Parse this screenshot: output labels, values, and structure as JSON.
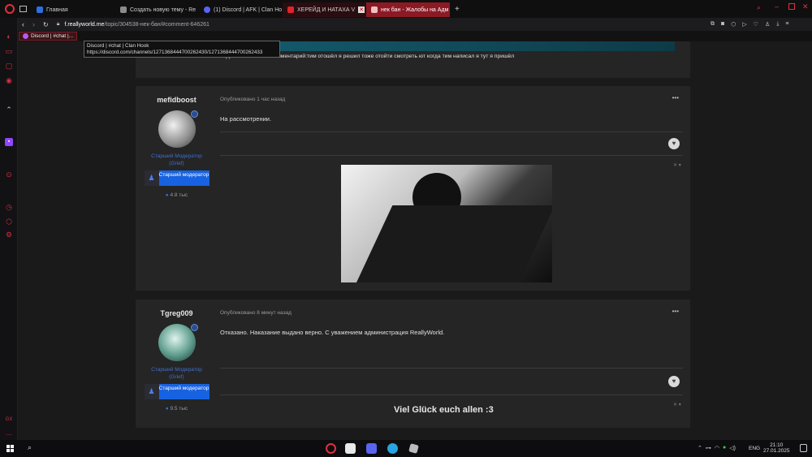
{
  "tabs": [
    {
      "label": "Главная",
      "fav": "#2d6fe0"
    },
    {
      "label": "Создать новую тему - Re",
      "fav": "#8c8c8c"
    },
    {
      "label": "(1) Discord | AFK | Clan Ho",
      "fav": "#5865f2"
    },
    {
      "label": "ХЕРЕЙД И НАТАХА V",
      "fav": "#e0242b"
    },
    {
      "label": "нек бан - Жалобы на Адм",
      "fav": "#c44"
    }
  ],
  "address": {
    "host": "f.reallyworld.me",
    "path": "/topic/304538-нек-бан/#comment-646261"
  },
  "bookmark": {
    "label": "Discord | #chat |..."
  },
  "tooltip": {
    "line1": "Discord | #chat | Clan Hook",
    "line2": "https://discord.com/channels/1271368444700262430/1271368444700262433"
  },
  "prev_post": {
    "text": "6. Дополнительный комментарий:тим отошёл я решил тоже отойти смотреть ют когда тим написал я тут я пришёл"
  },
  "posts": [
    {
      "author": "mefidboost",
      "role_line1": "Старший Модератор",
      "role_line2": "(Grief)",
      "badge": "Старший модератор",
      "reputation": "4.8 тыс",
      "meta": "Опубликовано 1 час назад",
      "content": "На рассмотрении."
    },
    {
      "author": "Tgreg009",
      "role_line1": "Старший Модератор",
      "role_line2": "(Grief)",
      "badge": "Старший модератор",
      "reputation": "9.5 тыс",
      "meta": "Опубликовано 8 минут назад",
      "content": "Отказано. Наказание выдано верно. С уважением администрация ReallyWorld.",
      "signature": "Viel Glück euch allen :3"
    }
  ],
  "tray": {
    "lang": "ENG",
    "time": "21:10",
    "date": "27.01.2025"
  },
  "icons": {
    "more": "more-dots-icon",
    "heart": "heart-icon",
    "comment": "comment-icon"
  }
}
